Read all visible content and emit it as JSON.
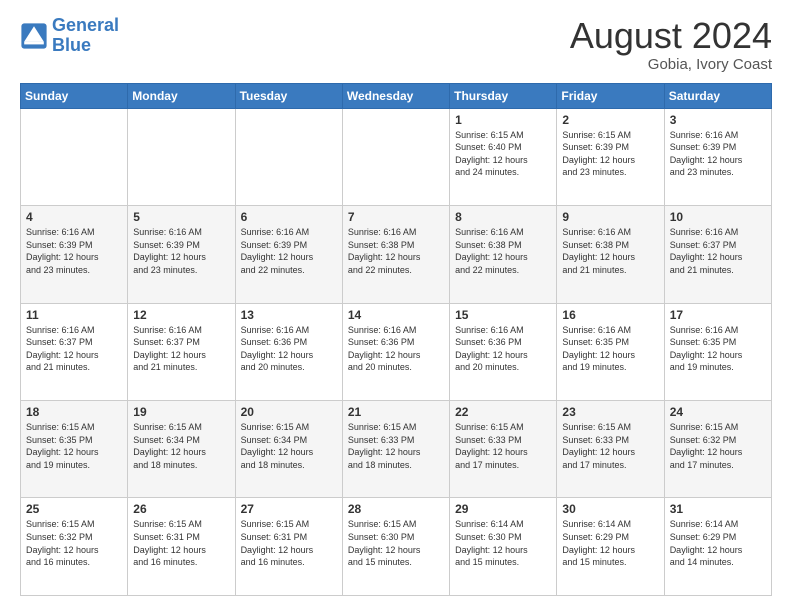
{
  "header": {
    "logo_line1": "General",
    "logo_line2": "Blue",
    "month": "August 2024",
    "location": "Gobia, Ivory Coast"
  },
  "weekdays": [
    "Sunday",
    "Monday",
    "Tuesday",
    "Wednesday",
    "Thursday",
    "Friday",
    "Saturday"
  ],
  "weeks": [
    [
      {
        "day": "",
        "info": ""
      },
      {
        "day": "",
        "info": ""
      },
      {
        "day": "",
        "info": ""
      },
      {
        "day": "",
        "info": ""
      },
      {
        "day": "1",
        "info": "Sunrise: 6:15 AM\nSunset: 6:40 PM\nDaylight: 12 hours\nand 24 minutes."
      },
      {
        "day": "2",
        "info": "Sunrise: 6:15 AM\nSunset: 6:39 PM\nDaylight: 12 hours\nand 23 minutes."
      },
      {
        "day": "3",
        "info": "Sunrise: 6:16 AM\nSunset: 6:39 PM\nDaylight: 12 hours\nand 23 minutes."
      }
    ],
    [
      {
        "day": "4",
        "info": "Sunrise: 6:16 AM\nSunset: 6:39 PM\nDaylight: 12 hours\nand 23 minutes."
      },
      {
        "day": "5",
        "info": "Sunrise: 6:16 AM\nSunset: 6:39 PM\nDaylight: 12 hours\nand 23 minutes."
      },
      {
        "day": "6",
        "info": "Sunrise: 6:16 AM\nSunset: 6:39 PM\nDaylight: 12 hours\nand 22 minutes."
      },
      {
        "day": "7",
        "info": "Sunrise: 6:16 AM\nSunset: 6:38 PM\nDaylight: 12 hours\nand 22 minutes."
      },
      {
        "day": "8",
        "info": "Sunrise: 6:16 AM\nSunset: 6:38 PM\nDaylight: 12 hours\nand 22 minutes."
      },
      {
        "day": "9",
        "info": "Sunrise: 6:16 AM\nSunset: 6:38 PM\nDaylight: 12 hours\nand 21 minutes."
      },
      {
        "day": "10",
        "info": "Sunrise: 6:16 AM\nSunset: 6:37 PM\nDaylight: 12 hours\nand 21 minutes."
      }
    ],
    [
      {
        "day": "11",
        "info": "Sunrise: 6:16 AM\nSunset: 6:37 PM\nDaylight: 12 hours\nand 21 minutes."
      },
      {
        "day": "12",
        "info": "Sunrise: 6:16 AM\nSunset: 6:37 PM\nDaylight: 12 hours\nand 21 minutes."
      },
      {
        "day": "13",
        "info": "Sunrise: 6:16 AM\nSunset: 6:36 PM\nDaylight: 12 hours\nand 20 minutes."
      },
      {
        "day": "14",
        "info": "Sunrise: 6:16 AM\nSunset: 6:36 PM\nDaylight: 12 hours\nand 20 minutes."
      },
      {
        "day": "15",
        "info": "Sunrise: 6:16 AM\nSunset: 6:36 PM\nDaylight: 12 hours\nand 20 minutes."
      },
      {
        "day": "16",
        "info": "Sunrise: 6:16 AM\nSunset: 6:35 PM\nDaylight: 12 hours\nand 19 minutes."
      },
      {
        "day": "17",
        "info": "Sunrise: 6:16 AM\nSunset: 6:35 PM\nDaylight: 12 hours\nand 19 minutes."
      }
    ],
    [
      {
        "day": "18",
        "info": "Sunrise: 6:15 AM\nSunset: 6:35 PM\nDaylight: 12 hours\nand 19 minutes."
      },
      {
        "day": "19",
        "info": "Sunrise: 6:15 AM\nSunset: 6:34 PM\nDaylight: 12 hours\nand 18 minutes."
      },
      {
        "day": "20",
        "info": "Sunrise: 6:15 AM\nSunset: 6:34 PM\nDaylight: 12 hours\nand 18 minutes."
      },
      {
        "day": "21",
        "info": "Sunrise: 6:15 AM\nSunset: 6:33 PM\nDaylight: 12 hours\nand 18 minutes."
      },
      {
        "day": "22",
        "info": "Sunrise: 6:15 AM\nSunset: 6:33 PM\nDaylight: 12 hours\nand 17 minutes."
      },
      {
        "day": "23",
        "info": "Sunrise: 6:15 AM\nSunset: 6:33 PM\nDaylight: 12 hours\nand 17 minutes."
      },
      {
        "day": "24",
        "info": "Sunrise: 6:15 AM\nSunset: 6:32 PM\nDaylight: 12 hours\nand 17 minutes."
      }
    ],
    [
      {
        "day": "25",
        "info": "Sunrise: 6:15 AM\nSunset: 6:32 PM\nDaylight: 12 hours\nand 16 minutes."
      },
      {
        "day": "26",
        "info": "Sunrise: 6:15 AM\nSunset: 6:31 PM\nDaylight: 12 hours\nand 16 minutes."
      },
      {
        "day": "27",
        "info": "Sunrise: 6:15 AM\nSunset: 6:31 PM\nDaylight: 12 hours\nand 16 minutes."
      },
      {
        "day": "28",
        "info": "Sunrise: 6:15 AM\nSunset: 6:30 PM\nDaylight: 12 hours\nand 15 minutes."
      },
      {
        "day": "29",
        "info": "Sunrise: 6:14 AM\nSunset: 6:30 PM\nDaylight: 12 hours\nand 15 minutes."
      },
      {
        "day": "30",
        "info": "Sunrise: 6:14 AM\nSunset: 6:29 PM\nDaylight: 12 hours\nand 15 minutes."
      },
      {
        "day": "31",
        "info": "Sunrise: 6:14 AM\nSunset: 6:29 PM\nDaylight: 12 hours\nand 14 minutes."
      }
    ]
  ]
}
